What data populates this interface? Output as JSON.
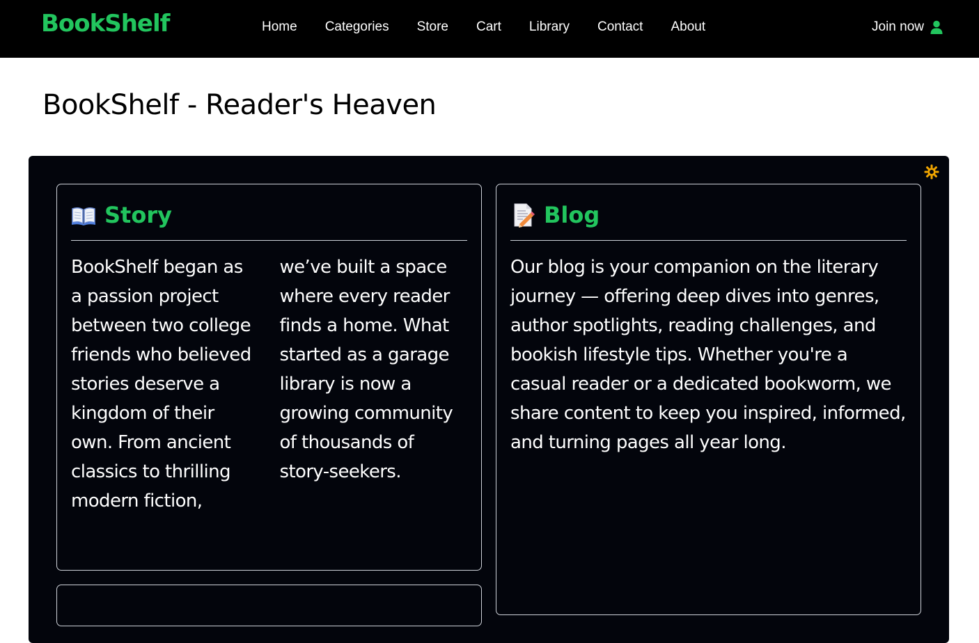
{
  "nav": {
    "logo": "BookShelf",
    "links": [
      "Home",
      "Categories",
      "Store",
      "Cart",
      "Library",
      "Contact",
      "About"
    ],
    "join_label": "Join now"
  },
  "page": {
    "title": "BookShelf - Reader's Heaven"
  },
  "cards": {
    "story": {
      "title": "Story",
      "text": "BookShelf began as a passion project between two college friends who believed stories deserve a kingdom of their own. From ancient classics to thrilling modern fiction, we’ve built a space where every reader finds a home. What started as a garage library is now a growing community of thousands of story-seekers."
    },
    "blog": {
      "title": "Blog",
      "text": "Our blog is your companion on the literary journey — offering deep dives into genres, author spotlights, reading challenges, and bookish lifestyle tips. Whether you're a casual reader or a dedicated bookworm, we share content to keep you inspired, informed, and turning pages all year long."
    }
  },
  "colors": {
    "accent": "#22c55e",
    "navbar": "#000000",
    "panel": "#03050c",
    "toggle": "#f2a600"
  },
  "icons": {
    "user": "user-icon",
    "theme": "sun-icon",
    "story": "open-book-icon",
    "blog": "memo-icon"
  }
}
